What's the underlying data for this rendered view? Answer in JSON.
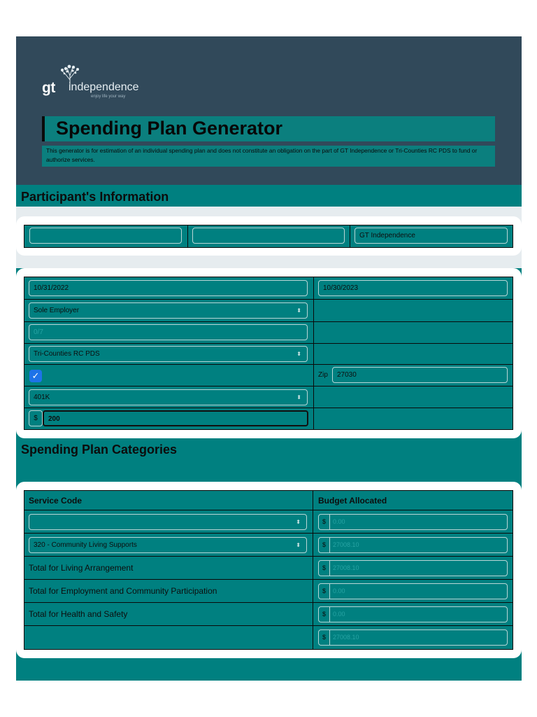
{
  "brand": {
    "logo_gt": "gt",
    "logo_word": "independence",
    "logo_tagline": "enjoy life your way"
  },
  "header": {
    "title": "Spending Plan Generator",
    "disclaimer": "This generator is for estimation of an individual spending plan and does not constitute an obligation on the part of GT Independence or Tri-Counties RC PDS to fund or authorize services."
  },
  "participant": {
    "section_title": "Participant's Information",
    "name_row": {
      "field1": "",
      "field2": "",
      "field3": "GT Independence"
    },
    "start_date": "10/31/2022",
    "end_date": "10/30/2023",
    "employer_type": "Sole Employer",
    "number_placeholder": "0/7",
    "regional_center": "Tri-Counties RC PDS",
    "checkbox_mark": "✓",
    "zip_label": "Zip",
    "zip_value": "27030",
    "retirement_plan": "401K",
    "currency": "$",
    "retirement_amount": "200"
  },
  "categories": {
    "section_title": "Spending Plan Categories",
    "col_service": "Service Code",
    "col_budget": "Budget Allocated",
    "rows": [
      {
        "label": "",
        "value": "0.00"
      },
      {
        "label": "320 - Community Living Supports",
        "value": "27008.10"
      },
      {
        "label": "Total for Living Arrangement",
        "value": "27008.10"
      },
      {
        "label": "Total for Employment and Community Participation",
        "value": "0.00"
      },
      {
        "label": "Total for Health and Safety",
        "value": "0.00"
      },
      {
        "label": "",
        "value": "27008.10"
      }
    ]
  },
  "colors": {
    "teal": "#008080",
    "header_bg": "#31495a",
    "checkbox_blue": "#1e73e8"
  }
}
